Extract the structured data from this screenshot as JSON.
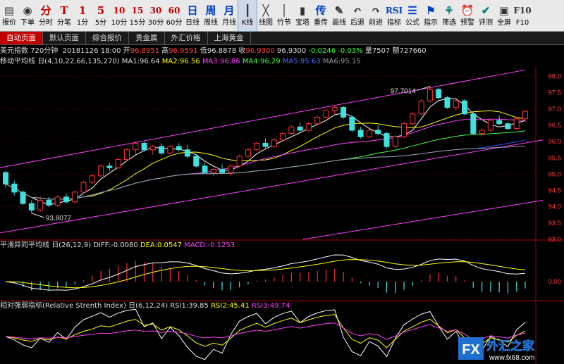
{
  "toolbar": {
    "items": [
      {
        "glyph": "▤",
        "label": "报价"
      },
      {
        "glyph": "◉",
        "label": "下单"
      },
      {
        "glyph": "分",
        "label": "分时"
      },
      {
        "glyph": "T",
        "label": "分笔"
      },
      {
        "glyph": "1",
        "label": "1分"
      },
      {
        "glyph": "5",
        "label": "5分"
      },
      {
        "glyph": "10",
        "label": "10分"
      },
      {
        "glyph": "15",
        "label": "15分"
      },
      {
        "glyph": "30",
        "label": "30分"
      },
      {
        "glyph": "60",
        "label": "60分"
      },
      {
        "glyph": "日",
        "label": "日线"
      },
      {
        "glyph": "周",
        "label": "周线"
      },
      {
        "glyph": "月",
        "label": "月线"
      },
      {
        "glyph": "┃",
        "label": "K线"
      },
      {
        "glyph": "╳",
        "label": "线图"
      },
      {
        "glyph": "│",
        "label": "竹节"
      },
      {
        "glyph": "▮",
        "label": "宝塔"
      },
      {
        "glyph": "传",
        "label": "重传"
      },
      {
        "glyph": "✎",
        "label": "画线"
      },
      {
        "glyph": "↶",
        "label": "后退"
      },
      {
        "glyph": "↷",
        "label": "前进"
      },
      {
        "glyph": "RSI",
        "label": "指标"
      },
      {
        "glyph": "☰",
        "label": "公式"
      },
      {
        "glyph": "⚑",
        "label": "指示"
      },
      {
        "glyph": "⚘",
        "label": "筛选"
      },
      {
        "glyph": "⏰",
        "label": "预警"
      },
      {
        "glyph": "✔",
        "label": "评测"
      },
      {
        "glyph": "▣",
        "label": "全屏"
      },
      {
        "glyph": "F10",
        "label": "F10"
      }
    ],
    "active_index": 13
  },
  "tabs": [
    "自动页面",
    "默认页面",
    "综合报价",
    "贵金属",
    "外汇价格",
    "上海黄金"
  ],
  "info": {
    "name": "美元指数 720分钟",
    "date": "20181126",
    "time": "18:00",
    "open_label": "开",
    "open": "96.8951",
    "high_label": "高",
    "high": "96.9591",
    "low_label": "低",
    "low": "96.8878",
    "close_label": "收",
    "close": "96.9300",
    "last": "96.9300",
    "change": "-0.0246",
    "change_pct": "-0.03%",
    "volume_label": "量",
    "volume": "7507",
    "amount_label": "额",
    "amount": "727660"
  },
  "ma_panel": {
    "title": "移动平均线",
    "params": "日(4,10,22,66,135,270)",
    "ma1": "MA1:96.64",
    "ma2": "MA2:96.56",
    "ma3": "MA3:96.86",
    "ma4": "MA4:96.29",
    "ma5": "MA5:95.63",
    "ma6": "MA6:95.15"
  },
  "macd_panel": {
    "title": "平滑异同平均线",
    "params": "日(26,12,9)",
    "diff": "DIFF:-0.0080",
    "dea": "DEA:0.0547",
    "macd": "MACD:-0.1253"
  },
  "rsi_panel": {
    "title": "相对强弱指标(Relative Strenth Index)",
    "params": "日(6,12,24)",
    "rsi1": "RSI1:39.85",
    "rsi2": "RSI2:45.41",
    "rsi3": "RSI3:49.74"
  },
  "price_axis": [
    "98.0",
    "97.0",
    "96.0",
    "95.0",
    "94.0",
    "93.0"
  ],
  "price_axis_minor": [
    "97.5",
    "96.5",
    "95.5",
    "94.5",
    "93.5"
  ],
  "macd_axis": [
    "0.00"
  ],
  "annotations": {
    "high": "97.7014",
    "low": "93.8077"
  },
  "watermark": {
    "logo": "FX",
    "text": "外汇之家",
    "url": "www.fx68.com"
  },
  "colors": {
    "up": "#ff3030",
    "down": "#40e0e0",
    "ma1": "#ffffff",
    "ma2": "#ffff00",
    "ma3": "#ff40ff",
    "ma4": "#40ff40",
    "ma5": "#3050ff",
    "ma6": "#9a9a9a",
    "channel": "#ff40ff"
  },
  "chart_data": {
    "type": "candlestick",
    "title": "美元指数 720分钟",
    "ylim": [
      93.0,
      98.25
    ],
    "candles": [
      [
        95.05,
        95.1,
        94.6,
        94.7
      ],
      [
        94.7,
        94.8,
        94.35,
        94.45
      ],
      [
        94.45,
        94.5,
        94.05,
        94.1
      ],
      [
        94.1,
        94.2,
        93.8,
        93.9
      ],
      [
        93.9,
        94.3,
        93.85,
        94.2
      ],
      [
        94.2,
        94.3,
        94.0,
        94.05
      ],
      [
        94.05,
        94.35,
        94.0,
        94.3
      ],
      [
        94.3,
        94.4,
        94.1,
        94.15
      ],
      [
        94.15,
        94.5,
        94.1,
        94.45
      ],
      [
        94.45,
        94.8,
        94.4,
        94.75
      ],
      [
        94.75,
        95.0,
        94.7,
        94.95
      ],
      [
        94.95,
        95.3,
        94.9,
        95.25
      ],
      [
        95.25,
        95.35,
        95.1,
        95.2
      ],
      [
        95.2,
        95.5,
        95.15,
        95.45
      ],
      [
        95.45,
        95.8,
        95.4,
        95.75
      ],
      [
        95.75,
        96.0,
        95.6,
        95.95
      ],
      [
        95.95,
        96.0,
        95.7,
        95.75
      ],
      [
        95.75,
        95.9,
        95.6,
        95.85
      ],
      [
        95.85,
        95.95,
        95.6,
        95.65
      ],
      [
        95.65,
        95.9,
        95.6,
        95.85
      ],
      [
        95.85,
        95.95,
        95.7,
        95.75
      ],
      [
        95.75,
        95.9,
        95.5,
        95.55
      ],
      [
        95.55,
        95.6,
        95.2,
        95.25
      ],
      [
        95.25,
        95.35,
        95.0,
        95.05
      ],
      [
        95.05,
        95.2,
        94.95,
        95.15
      ],
      [
        95.15,
        95.3,
        95.0,
        95.05
      ],
      [
        95.05,
        95.3,
        94.95,
        95.25
      ],
      [
        95.25,
        95.6,
        95.2,
        95.55
      ],
      [
        95.55,
        95.8,
        95.5,
        95.75
      ],
      [
        95.75,
        96.0,
        95.7,
        95.95
      ],
      [
        95.95,
        96.1,
        95.8,
        95.85
      ],
      [
        95.85,
        96.1,
        95.8,
        96.05
      ],
      [
        96.05,
        96.3,
        96.0,
        96.25
      ],
      [
        96.25,
        96.5,
        96.2,
        96.45
      ],
      [
        96.45,
        96.6,
        96.3,
        96.35
      ],
      [
        96.35,
        96.6,
        96.3,
        96.55
      ],
      [
        96.55,
        96.8,
        96.5,
        96.75
      ],
      [
        96.75,
        97.0,
        96.7,
        96.95
      ],
      [
        96.95,
        97.1,
        96.85,
        97.05
      ],
      [
        97.05,
        97.1,
        96.7,
        96.75
      ],
      [
        96.75,
        96.8,
        96.3,
        96.35
      ],
      [
        96.35,
        96.45,
        96.1,
        96.15
      ],
      [
        96.15,
        96.4,
        96.1,
        96.35
      ],
      [
        96.35,
        96.5,
        96.2,
        96.25
      ],
      [
        96.25,
        96.3,
        95.8,
        95.85
      ],
      [
        95.85,
        96.2,
        95.8,
        96.15
      ],
      [
        96.15,
        96.6,
        96.1,
        96.55
      ],
      [
        96.55,
        96.9,
        96.5,
        96.85
      ],
      [
        96.85,
        97.3,
        96.8,
        97.25
      ],
      [
        97.25,
        97.7,
        97.2,
        97.6
      ],
      [
        97.6,
        97.65,
        97.3,
        97.35
      ],
      [
        97.35,
        97.4,
        97.0,
        97.05
      ],
      [
        97.05,
        97.3,
        96.95,
        97.25
      ],
      [
        97.25,
        97.3,
        96.8,
        96.85
      ],
      [
        96.85,
        96.9,
        96.2,
        96.25
      ],
      [
        96.25,
        96.4,
        96.15,
        96.35
      ],
      [
        96.35,
        96.7,
        96.3,
        96.65
      ],
      [
        96.65,
        96.8,
        96.5,
        96.55
      ],
      [
        96.55,
        96.6,
        96.35,
        96.4
      ],
      [
        96.4,
        96.75,
        96.35,
        96.7
      ],
      [
        96.7,
        96.96,
        96.6,
        96.93
      ]
    ]
  }
}
